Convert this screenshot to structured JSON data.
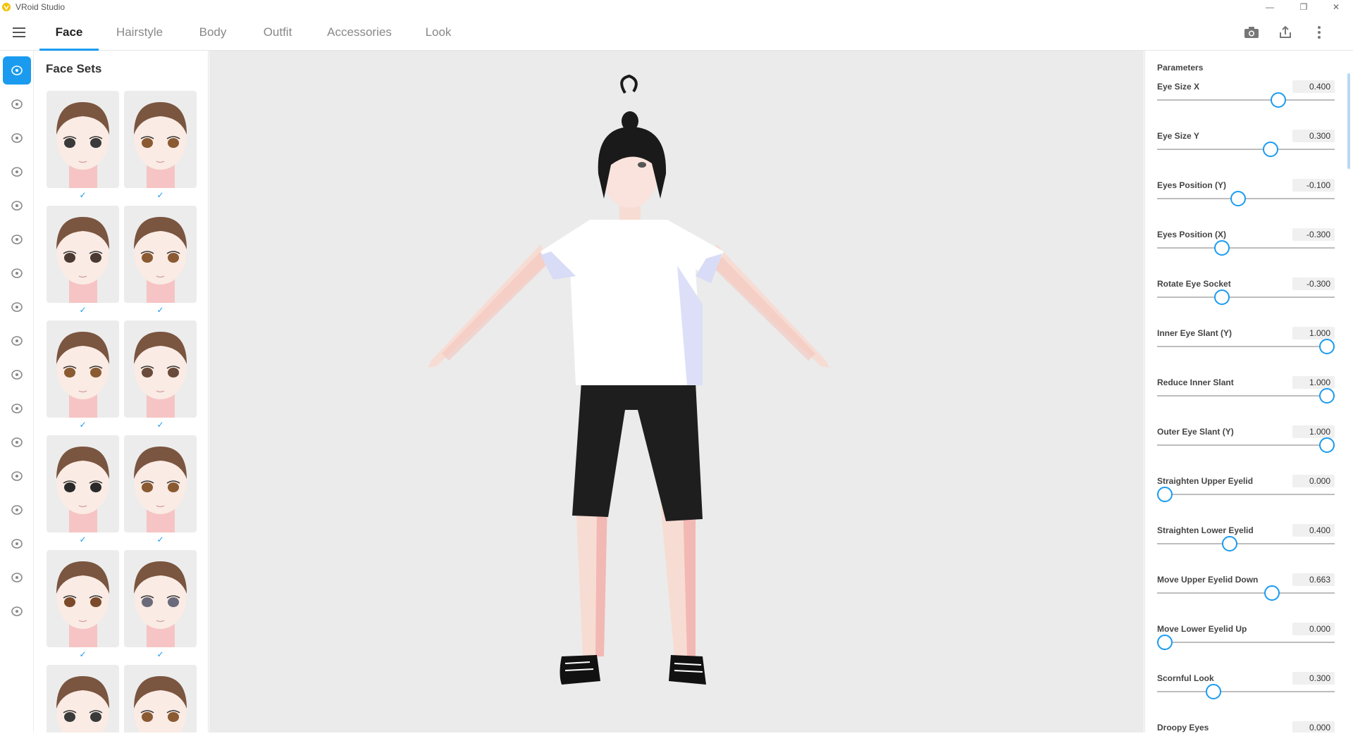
{
  "app": {
    "title": "VRoid Studio"
  },
  "window_controls": {
    "minimize": "—",
    "maximize": "❐",
    "close": "✕"
  },
  "tabs": [
    {
      "label": "Face",
      "active": true
    },
    {
      "label": "Hairstyle",
      "active": false
    },
    {
      "label": "Body",
      "active": false
    },
    {
      "label": "Outfit",
      "active": false
    },
    {
      "label": "Accessories",
      "active": false
    },
    {
      "label": "Look",
      "active": false
    }
  ],
  "toolbar_icons": [
    "camera-icon",
    "export-icon",
    "more-vertical-icon"
  ],
  "rail_icons": [
    "face-set-icon",
    "eye-icon",
    "ear-icon",
    "iris-icon",
    "face-outline-icon",
    "eyebrow-icon",
    "eyelash-icon",
    "makeup-brush-icon",
    "eyelid-icon",
    "nose-icon",
    "mouth-icon",
    "lips-icon",
    "teeth-icon",
    "pen-icon",
    "face-shape-icon",
    "head-side-icon",
    "emoji-icon"
  ],
  "face_sets": {
    "title": "Face Sets",
    "check": "✓",
    "items": [
      {
        "eye_color": "#3a3a3a",
        "checked": true
      },
      {
        "eye_color": "#8a5a32",
        "checked": true
      },
      {
        "eye_color": "#4a3a32",
        "checked": true
      },
      {
        "eye_color": "#8a5a32",
        "checked": true
      },
      {
        "eye_color": "#8a5a32",
        "checked": true
      },
      {
        "eye_color": "#6a4a3a",
        "checked": true
      },
      {
        "eye_color": "#2a2a2a",
        "checked": true
      },
      {
        "eye_color": "#8a5a32",
        "checked": true
      },
      {
        "eye_color": "#7a4a2a",
        "checked": true
      },
      {
        "eye_color": "#6a6a7a",
        "checked": true
      },
      {
        "eye_color": "#3a3a3a",
        "checked": false
      },
      {
        "eye_color": "#8a5a32",
        "checked": false
      }
    ]
  },
  "parameters": {
    "title": "Parameters",
    "items": [
      {
        "label": "Eye Size X",
        "value": "0.400",
        "level": 0.7
      },
      {
        "label": "Eye Size Y",
        "value": "0.300",
        "level": 0.65
      },
      {
        "label": "Eyes Position (Y)",
        "value": "-0.100",
        "level": 0.45
      },
      {
        "label": "Eyes Position (X)",
        "value": "-0.300",
        "level": 0.35
      },
      {
        "label": "Rotate Eye Socket",
        "value": "-0.300",
        "level": 0.35
      },
      {
        "label": "Inner Eye Slant (Y)",
        "value": "1.000",
        "level": 1.0
      },
      {
        "label": "Reduce Inner Slant",
        "value": "1.000",
        "level": 1.0
      },
      {
        "label": "Outer Eye Slant (Y)",
        "value": "1.000",
        "level": 1.0
      },
      {
        "label": "Straighten Upper Eyelid",
        "value": "0.000",
        "level": 0.0
      },
      {
        "label": "Straighten Lower Eyelid",
        "value": "0.400",
        "level": 0.4
      },
      {
        "label": "Move Upper Eyelid Down",
        "value": "0.663",
        "level": 0.663
      },
      {
        "label": "Move Lower Eyelid Up",
        "value": "0.000",
        "level": 0.0
      },
      {
        "label": "Scornful Look",
        "value": "0.300",
        "level": 0.3
      },
      {
        "label": "Droopy Eyes",
        "value": "0.000",
        "level": 0.0
      }
    ]
  },
  "colors": {
    "accent": "#1a9bf0",
    "viewport_bg": "#ebebeb"
  }
}
